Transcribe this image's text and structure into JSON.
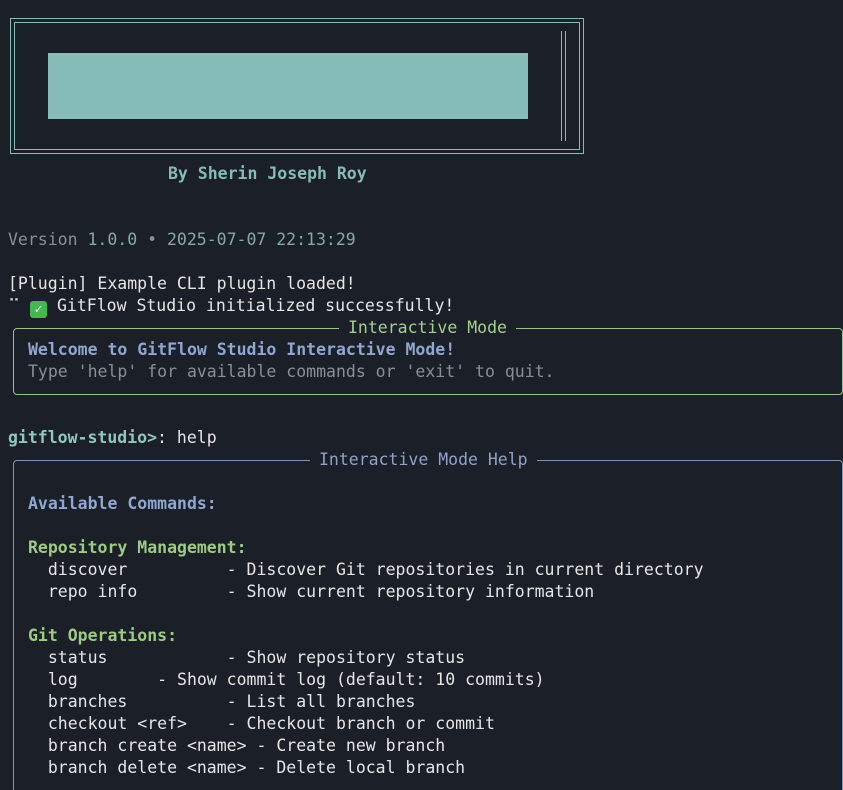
{
  "banner": {
    "author": "By Sherin Joseph Roy"
  },
  "version_line": {
    "prefix": "Version ",
    "version": "1.0.0",
    "separator": " • ",
    "timestamp": "2025-07-07 22:13:29"
  },
  "log": {
    "plugin_line": "[Plugin] Example CLI plugin loaded!",
    "spinner_glyph": "⠉",
    "init_line": "GitFlow Studio initialized successfully!"
  },
  "interactive_panel": {
    "title": "Interactive Mode",
    "welcome": "Welcome to GitFlow Studio Interactive Mode!",
    "hint": "Type 'help' for available commands or 'exit' to quit."
  },
  "prompt": {
    "label": "gitflow-studio>",
    "separator": ": ",
    "command": "help"
  },
  "help_panel": {
    "title": "Interactive Mode Help",
    "heading": "Available Commands:",
    "sections": [
      {
        "title": "Repository Management:",
        "commands": [
          "  discover          - Discover Git repositories in current directory",
          "  repo info         - Show current repository information"
        ]
      },
      {
        "title": "Git Operations:",
        "commands": [
          "  status            - Show repository status",
          "  log        - Show commit log (default: 10 commits)",
          "  branches          - List all branches",
          "  checkout <ref>    - Checkout branch or commit",
          "  branch create <name> - Create new branch",
          "  branch delete <name> - Delete local branch"
        ]
      }
    ]
  },
  "colors": {
    "background": "#1b1f27",
    "banner": "#86bcb8",
    "green_accent": "#9ccc82",
    "blue_accent": "#8fa7d2"
  },
  "icons": {
    "check": "white-check-mark-icon",
    "spinner": "braille-spinner-icon"
  }
}
